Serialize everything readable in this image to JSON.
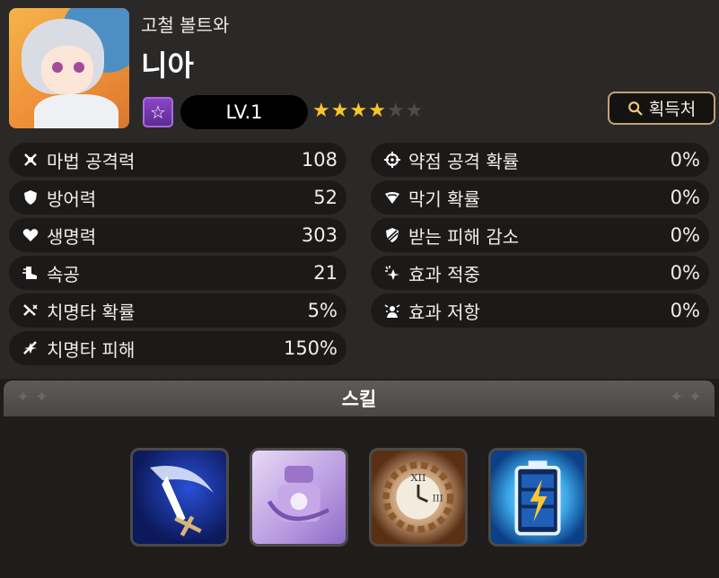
{
  "character": {
    "subtitle": "고철 볼트와",
    "name": "니아",
    "level_label": "LV.1",
    "stars_filled": 4,
    "stars_total": 6
  },
  "buttons": {
    "acquire": "획득처"
  },
  "stats_left": [
    {
      "icon": "magic-attack-icon",
      "label": "마법 공격력",
      "value": "108"
    },
    {
      "icon": "shield-icon",
      "label": "방어력",
      "value": "52"
    },
    {
      "icon": "heart-icon",
      "label": "생명력",
      "value": "303"
    },
    {
      "icon": "boot-icon",
      "label": "속공",
      "value": "21"
    },
    {
      "icon": "crit-chance-icon",
      "label": "치명타 확률",
      "value": "5%"
    },
    {
      "icon": "crit-damage-icon",
      "label": "치명타 피해",
      "value": "150%"
    }
  ],
  "stats_right": [
    {
      "icon": "crosshair-icon",
      "label": "약점 공격 확률",
      "value": "0%"
    },
    {
      "icon": "block-icon",
      "label": "막기 확률",
      "value": "0%"
    },
    {
      "icon": "damage-reduction-icon",
      "label": "받는 피해 감소",
      "value": "0%"
    },
    {
      "icon": "effect-hit-icon",
      "label": "효과 적중",
      "value": "0%"
    },
    {
      "icon": "effect-resist-icon",
      "label": "효과 저항",
      "value": "0%"
    }
  ],
  "skills": {
    "title": "스킬",
    "items": [
      {
        "icon": "blade-skill-icon"
      },
      {
        "icon": "summon-skill-icon"
      },
      {
        "icon": "clock-gear-skill-icon"
      },
      {
        "icon": "battery-skill-icon"
      }
    ]
  },
  "colors": {
    "star_on": "#f7c52c",
    "badge_purple": "#8b45c6",
    "button_border": "#c2a370"
  }
}
